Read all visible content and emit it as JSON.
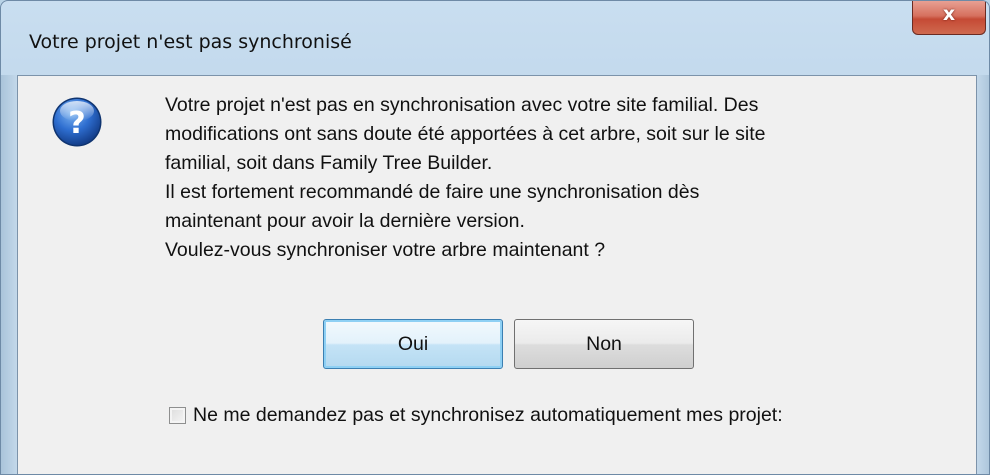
{
  "window": {
    "title": "Votre projet n'est pas synchronisé",
    "close_label": "x"
  },
  "dialog": {
    "icon": "question-icon",
    "message_lines": [
      "Votre projet n'est pas en synchronisation avec votre site familial. Des",
      "modifications ont sans doute été apportées à cet arbre, soit sur le site",
      "familial, soit dans Family Tree Builder.",
      "Il est fortement recommandé de faire une synchronisation dès",
      "maintenant pour avoir la dernière version.",
      "Voulez-vous synchroniser votre arbre maintenant ?"
    ],
    "buttons": {
      "yes_label": "Oui",
      "no_label": "Non"
    },
    "checkbox": {
      "checked": false,
      "label": "Ne me demandez pas et synchronisez automatiquement mes projet:"
    }
  },
  "colors": {
    "frame": "#b9d3e6",
    "client_bg": "#f0f0f0",
    "close_button": "#c54a35",
    "default_button_border": "#3c7fb1"
  }
}
